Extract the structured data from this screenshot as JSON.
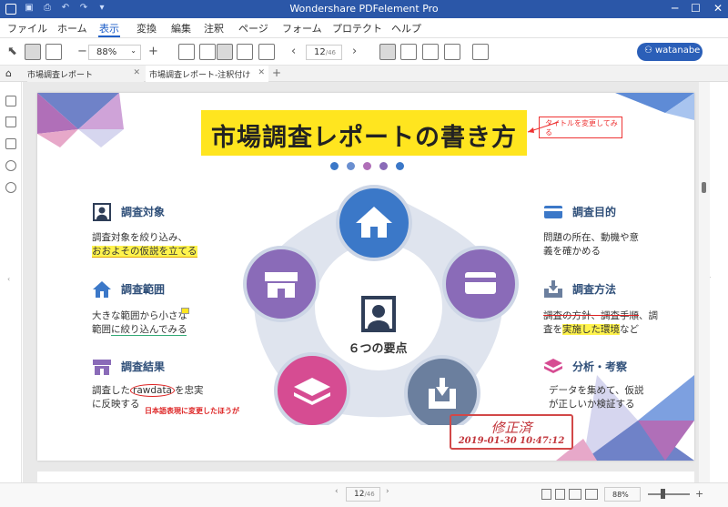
{
  "titlebar": {
    "title": "Wondershare PDFelement Pro",
    "controls": [
      "─",
      "☐",
      "✕"
    ]
  },
  "menu": {
    "items": [
      "ファイル",
      "ホーム",
      "表示",
      "変換",
      "編集",
      "注釈",
      "ページ",
      "フォーム",
      "プロテクト",
      "ヘルプ"
    ],
    "active": "表示"
  },
  "toolbar": {
    "zoom": "88%",
    "page_current": "12",
    "page_total": "/46",
    "user": "watanabe"
  },
  "tabs": [
    {
      "label": "市場調査レポート"
    },
    {
      "label": "市場調査レポート-注釈付け"
    }
  ],
  "document": {
    "title": "市場調査レポートの書き方",
    "title_note": "タイトルを変更してみる",
    "center_label": "６つの要点",
    "sections": {
      "target": {
        "title": "調査対象",
        "line1": "調査対象を絞り込み、",
        "line2": "おおよその仮説を立てる"
      },
      "range": {
        "title": "調査範囲",
        "line1": "大きな範囲から小さな",
        "line2_a": "範囲",
        "line2_b": "に絞り込んでみる"
      },
      "result": {
        "title": "調査結果",
        "line1_a": "調査した",
        "line1_b": "rawdata",
        "line1_c": "を忠実",
        "line2": "に反映する",
        "note": "日本語表現に変更したほうが"
      },
      "purpose": {
        "title": "調査目的",
        "line1": "問題の所在、動機や意",
        "line2": "義を確かめる"
      },
      "method": {
        "title": "調査方法",
        "line1_a": "調査の方針、",
        "line1_b": "調査手順",
        "line1_c": "、調",
        "line2_a": "査を",
        "line2_b": "実施した環境",
        "line2_c": "など"
      },
      "analysis": {
        "title": "分析・考察",
        "line1": "データを集めて、仮説",
        "line2": "が正しいか検証する"
      }
    },
    "stamp": {
      "name": "修正済",
      "datetime": "2019-01-30 10:47:12"
    }
  },
  "status": {
    "page_current": "12",
    "page_total": "/46",
    "zoom": "88%"
  },
  "colors": {
    "accent": "#2b57a8",
    "banner": "#ffe51f",
    "circle_blue": "#3b78c8",
    "circle_purple": "#8a6bb8",
    "circle_pink": "#d64c92",
    "circle_slate": "#6b7f9e",
    "stamp": "#c2353b"
  }
}
